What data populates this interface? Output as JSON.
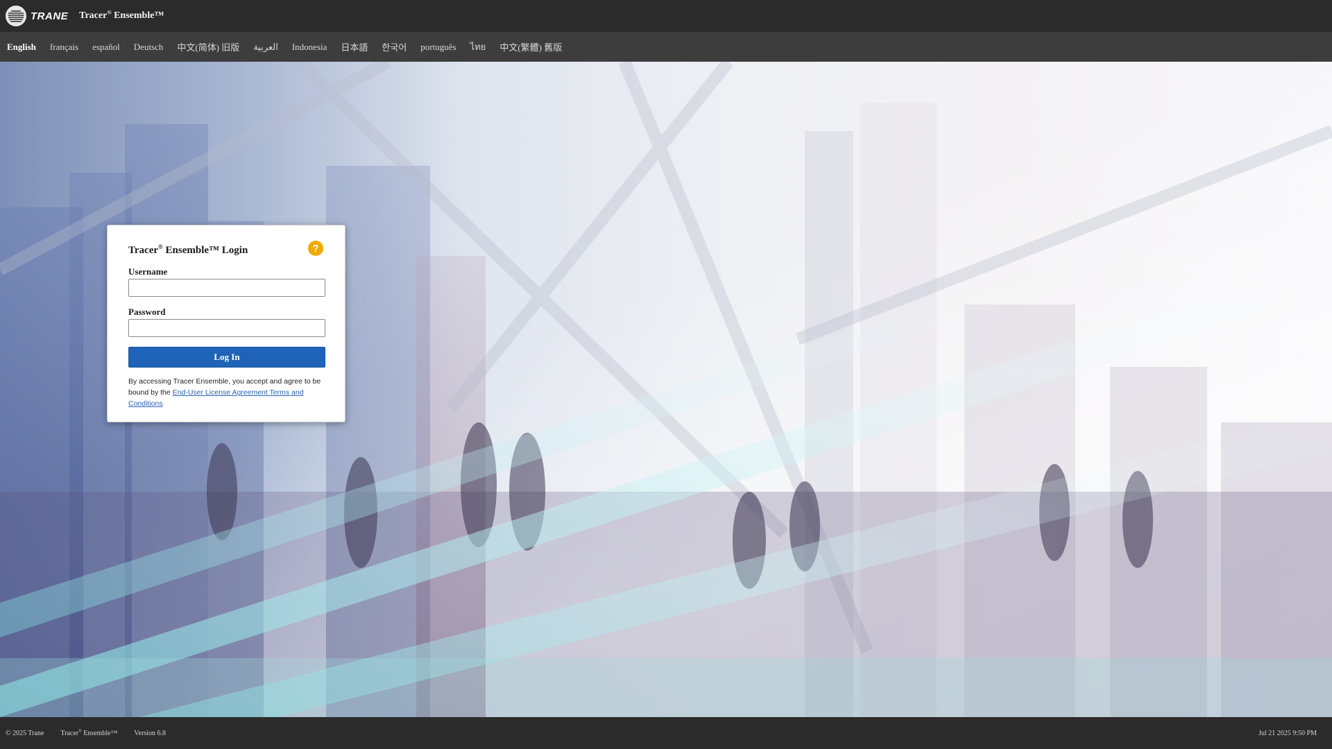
{
  "header": {
    "logo_text": "TRANE",
    "title_prefix": "Tracer",
    "title_reg": "®",
    "title_suffix": " Ensemble™"
  },
  "languages": [
    {
      "label": "English",
      "active": true
    },
    {
      "label": "français"
    },
    {
      "label": "español"
    },
    {
      "label": "Deutsch"
    },
    {
      "label": "中文(简体) 旧版"
    },
    {
      "label": "العربية"
    },
    {
      "label": "Indonesia"
    },
    {
      "label": "日本語"
    },
    {
      "label": "한국어"
    },
    {
      "label": "português"
    },
    {
      "label": "ไทย"
    },
    {
      "label": "中文(繁體) 舊版"
    }
  ],
  "login": {
    "title_prefix": "Tracer",
    "title_reg": "®",
    "title_suffix": " Ensemble™ Login",
    "help_glyph": "?",
    "username_label": "Username",
    "username_value": "",
    "password_label": "Password",
    "password_value": "",
    "login_button": "Log In",
    "eula_text": "By accessing Tracer Ensemble, you accept and agree to be bound by the ",
    "eula_link": "End-User License Agreement Terms and Conditions"
  },
  "footer": {
    "copyright": "© 2025 Trane",
    "product_prefix": "Tracer",
    "product_reg": "®",
    "product_suffix": " Ensemble™",
    "version": "Version 6.8",
    "datetime": "Jul 21 2025 9:50 PM"
  },
  "colors": {
    "header_bg": "#2b2b2b",
    "langbar_bg": "#3d3d3d",
    "button_blue": "#1e63b7",
    "help_orange": "#f2a900",
    "link_blue": "#2b63b2"
  },
  "icons": {
    "logo": "trane-logo-icon",
    "help": "help-circle-icon"
  }
}
